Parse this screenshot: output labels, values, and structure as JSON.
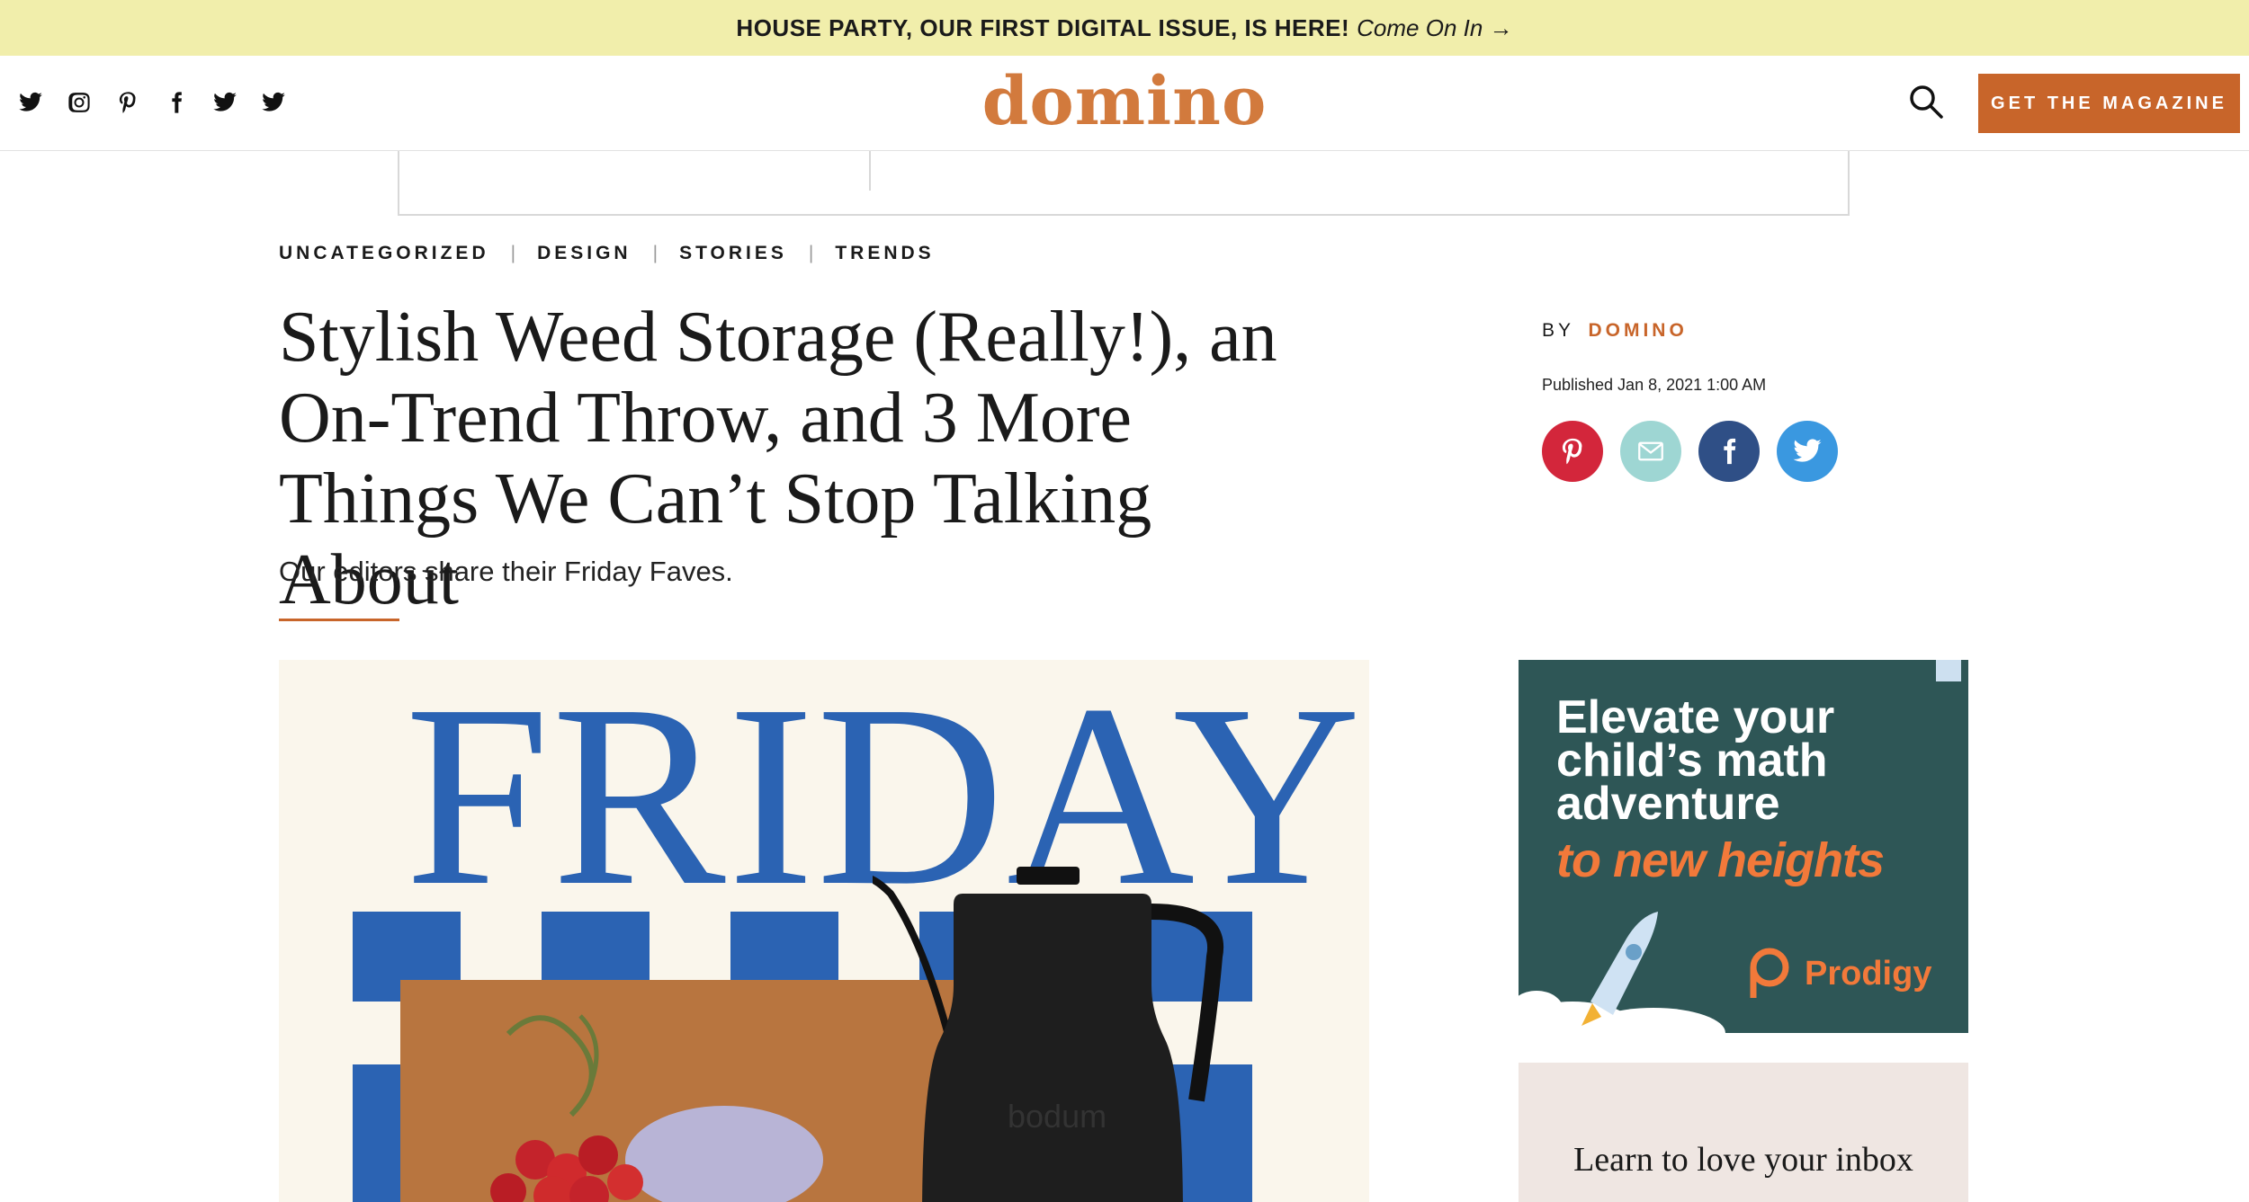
{
  "promo": {
    "headline": "HOUSE PARTY, OUR FIRST DIGITAL ISSUE, IS HERE!",
    "link_text": "Come On In →"
  },
  "header": {
    "logo": "domino",
    "social_icons": [
      "twitter-icon",
      "instagram-icon",
      "pinterest-icon",
      "facebook-icon",
      "twitter-icon",
      "twitter-icon"
    ],
    "cta_label": "GET THE MAGAZINE"
  },
  "article": {
    "categories": [
      "UNCATEGORIZED",
      "DESIGN",
      "STORIES",
      "TRENDS"
    ],
    "title": "Stylish Weed Storage (Really!), an On-Trend Throw, and 3 More Things We Can’t Stop Talking About",
    "dek": "Our editors share their Friday Faves.",
    "byline_prefix": "BY",
    "author": "DOMINO",
    "published": "Published Jan 8, 2021 1:00 AM",
    "share_buttons": [
      {
        "name": "pinterest",
        "color": "#d3263b"
      },
      {
        "name": "email",
        "color": "#9ed6d3"
      },
      {
        "name": "facebook",
        "color": "#2f4f86"
      },
      {
        "name": "twitter",
        "color": "#3a98e0"
      }
    ],
    "hero": {
      "word": "FRIDAY",
      "kettle_brand": "bodum"
    }
  },
  "sidebar": {
    "ad": {
      "headline_lines": [
        "Elevate your",
        "child’s math",
        "adventure"
      ],
      "accent": "to new heights",
      "brand": "Prodigy"
    },
    "newsletter": {
      "text": "Learn to love your inbox"
    }
  },
  "colors": {
    "brand_orange": "#c8652a",
    "logo_orange": "#d27a3d",
    "promo_bg": "#f1eeab",
    "friday_blue": "#2b63b3",
    "ad_bg": "#2e5656"
  }
}
